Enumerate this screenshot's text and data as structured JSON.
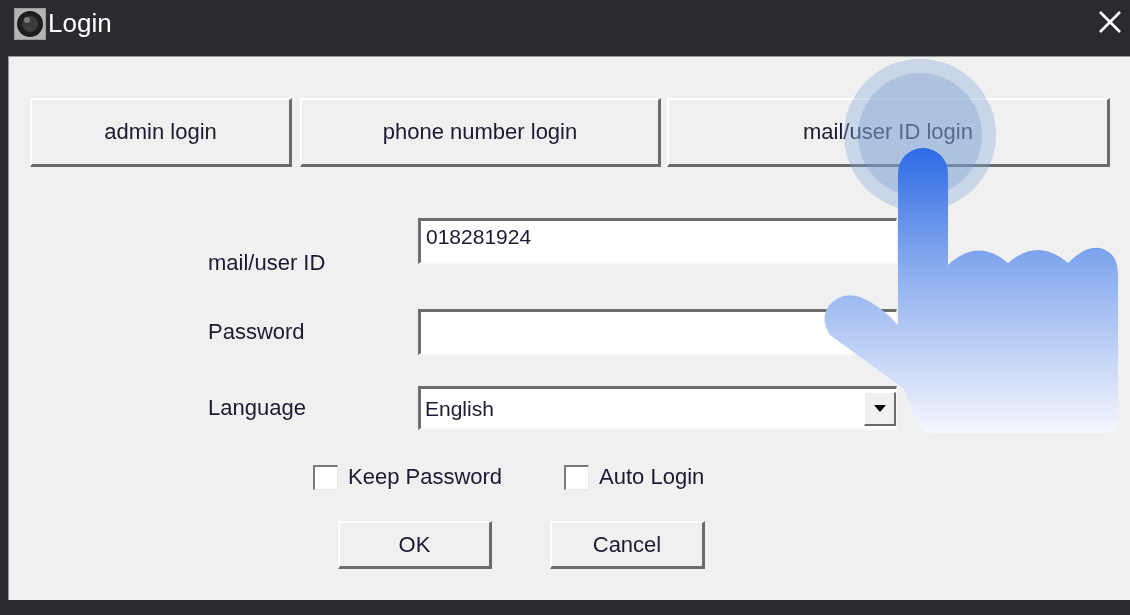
{
  "window": {
    "title": "Login"
  },
  "login_modes": [
    {
      "label": "admin login"
    },
    {
      "label": "phone number login"
    },
    {
      "label": "mail/user ID login"
    }
  ],
  "form": {
    "fields": [
      {
        "kind": "text",
        "label": "mail/user ID",
        "value": "018281924"
      },
      {
        "kind": "password",
        "label": "Password"
      },
      {
        "kind": "dropdown",
        "label": "Language",
        "value": "English"
      }
    ]
  },
  "options": [
    {
      "label": "Keep Password",
      "checked": false
    },
    {
      "label": "Auto Login",
      "checked": false
    }
  ],
  "buttons": [
    {
      "label": "OK"
    },
    {
      "label": "Cancel"
    }
  ]
}
